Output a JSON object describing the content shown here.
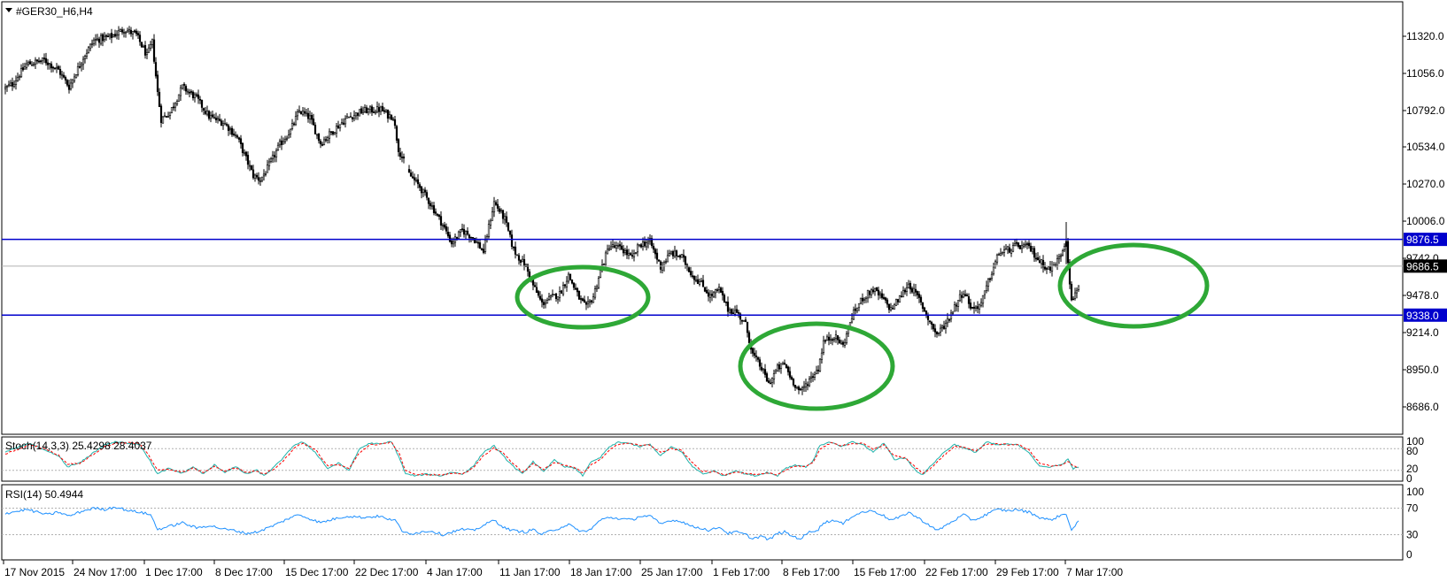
{
  "window": {
    "title": "#GER30_H6,H4"
  },
  "price_panel": {
    "yticks": [
      11320.0,
      11056.0,
      10792.0,
      10534.0,
      10270.0,
      10006.0,
      9742.0,
      9478.0,
      9214.0,
      8950.0,
      8686.0
    ],
    "ytick_labels": [
      "11320.0",
      "11056.0",
      "10792.0",
      "10534.0",
      "10270.0",
      "10006.0",
      "9742.0",
      "9478.0",
      "9214.0",
      "8950.0",
      "8686.0"
    ],
    "ylim": [
      8640,
      11480
    ],
    "resistance": {
      "value": 9876.5,
      "label": "9876.5",
      "color": "#0000cc"
    },
    "support": {
      "value": 9338.0,
      "label": "9338.0",
      "color": "#0000cc"
    },
    "current": {
      "value": 9686.5,
      "label": "9686.5"
    },
    "ellipse_color": "#2ea836"
  },
  "stoch_panel": {
    "title": "Stoch(14,3,3) 25.4298 28.4037",
    "levels": [
      "100",
      "80",
      "20",
      "0"
    ],
    "main_color": "#20b2aa",
    "signal_color": "#ff0000"
  },
  "rsi_panel": {
    "title": "RSI(14) 50.4944",
    "levels": [
      "100",
      "70",
      "30",
      "0"
    ],
    "color": "#1e90ff"
  },
  "x_axis": {
    "labels": [
      "17 Nov 2015",
      "24 Nov 17:00",
      "1 Dec 17:00",
      "8 Dec 17:00",
      "15 Dec 17:00",
      "22 Dec 17:00",
      "4 Jan 17:00",
      "11 Jan 17:00",
      "18 Jan 17:00",
      "25 Jan 17:00",
      "1 Feb 17:00",
      "8 Feb 17:00",
      "15 Feb 17:00",
      "22 Feb 17:00",
      "29 Feb 17:00",
      "7 Mar 17:00"
    ]
  },
  "chart_data": {
    "type": "candlestick",
    "title": "#GER30_H6,H4",
    "ylim": [
      8640,
      11480
    ],
    "anchors": [
      [
        0,
        10950
      ],
      [
        4,
        10980
      ],
      [
        12,
        11120
      ],
      [
        22,
        11150
      ],
      [
        30,
        11080
      ],
      [
        36,
        10960
      ],
      [
        44,
        11170
      ],
      [
        50,
        11290
      ],
      [
        60,
        11320
      ],
      [
        67,
        11370
      ],
      [
        74,
        11330
      ],
      [
        80,
        11180
      ],
      [
        83,
        11280
      ],
      [
        86,
        10920
      ],
      [
        88,
        10730
      ],
      [
        93,
        10780
      ],
      [
        100,
        10960
      ],
      [
        108,
        10880
      ],
      [
        115,
        10750
      ],
      [
        124,
        10700
      ],
      [
        131,
        10600
      ],
      [
        140,
        10330
      ],
      [
        144,
        10300
      ],
      [
        148,
        10380
      ],
      [
        155,
        10550
      ],
      [
        161,
        10650
      ],
      [
        166,
        10790
      ],
      [
        172,
        10740
      ],
      [
        178,
        10560
      ],
      [
        186,
        10660
      ],
      [
        193,
        10740
      ],
      [
        202,
        10790
      ],
      [
        212,
        10800
      ],
      [
        216,
        10760
      ],
      [
        219,
        10750
      ],
      [
        222,
        10520
      ],
      [
        228,
        10340
      ],
      [
        234,
        10250
      ],
      [
        240,
        10130
      ],
      [
        247,
        9980
      ],
      [
        252,
        9850
      ],
      [
        258,
        9940
      ],
      [
        264,
        9890
      ],
      [
        270,
        9790
      ],
      [
        276,
        10140
      ],
      [
        282,
        10020
      ],
      [
        287,
        9800
      ],
      [
        294,
        9680
      ],
      [
        298,
        9550
      ],
      [
        303,
        9420
      ],
      [
        308,
        9460
      ],
      [
        313,
        9490
      ],
      [
        318,
        9620
      ],
      [
        321,
        9540
      ],
      [
        324,
        9460
      ],
      [
        328,
        9390
      ],
      [
        332,
        9470
      ],
      [
        336,
        9650
      ],
      [
        341,
        9830
      ],
      [
        348,
        9810
      ],
      [
        354,
        9740
      ],
      [
        358,
        9840
      ],
      [
        364,
        9860
      ],
      [
        370,
        9680
      ],
      [
        376,
        9780
      ],
      [
        382,
        9750
      ],
      [
        388,
        9620
      ],
      [
        393,
        9560
      ],
      [
        398,
        9470
      ],
      [
        403,
        9520
      ],
      [
        408,
        9380
      ],
      [
        413,
        9360
      ],
      [
        418,
        9270
      ],
      [
        422,
        9060
      ],
      [
        427,
        8960
      ],
      [
        431,
        8850
      ],
      [
        436,
        8960
      ],
      [
        440,
        8990
      ],
      [
        444,
        8880
      ],
      [
        449,
        8790
      ],
      [
        454,
        8880
      ],
      [
        459,
        8960
      ],
      [
        462,
        9150
      ],
      [
        468,
        9190
      ],
      [
        473,
        9120
      ],
      [
        478,
        9330
      ],
      [
        484,
        9460
      ],
      [
        490,
        9520
      ],
      [
        495,
        9460
      ],
      [
        500,
        9380
      ],
      [
        505,
        9460
      ],
      [
        510,
        9560
      ],
      [
        516,
        9450
      ],
      [
        522,
        9290
      ],
      [
        526,
        9200
      ],
      [
        531,
        9280
      ],
      [
        536,
        9400
      ],
      [
        541,
        9510
      ],
      [
        546,
        9380
      ],
      [
        551,
        9420
      ],
      [
        556,
        9610
      ],
      [
        561,
        9780
      ],
      [
        566,
        9800
      ],
      [
        571,
        9830
      ],
      [
        578,
        9820
      ],
      [
        584,
        9720
      ],
      [
        590,
        9660
      ],
      [
        595,
        9740
      ],
      [
        599,
        9880
      ],
      [
        602,
        9430
      ],
      [
        606,
        9560
      ]
    ],
    "horizontal_lines": [
      {
        "label": "9876.5",
        "value": 9876.5
      },
      {
        "label": "9338.0",
        "value": 9338.0
      }
    ],
    "current_price": 9686.5
  },
  "stoch_data": {
    "ylim": [
      0,
      100
    ],
    "main": [
      [
        0,
        70
      ],
      [
        8,
        85
      ],
      [
        14,
        95
      ],
      [
        22,
        75
      ],
      [
        30,
        60
      ],
      [
        35,
        30
      ],
      [
        42,
        40
      ],
      [
        50,
        70
      ],
      [
        56,
        90
      ],
      [
        62,
        98
      ],
      [
        70,
        95
      ],
      [
        76,
        92
      ],
      [
        80,
        60
      ],
      [
        86,
        10
      ],
      [
        92,
        25
      ],
      [
        100,
        12
      ],
      [
        106,
        30
      ],
      [
        112,
        10
      ],
      [
        118,
        35
      ],
      [
        124,
        15
      ],
      [
        130,
        30
      ],
      [
        136,
        10
      ],
      [
        142,
        20
      ],
      [
        146,
        5
      ],
      [
        152,
        30
      ],
      [
        158,
        60
      ],
      [
        163,
        90
      ],
      [
        168,
        98
      ],
      [
        175,
        70
      ],
      [
        182,
        25
      ],
      [
        188,
        40
      ],
      [
        194,
        20
      ],
      [
        200,
        80
      ],
      [
        206,
        95
      ],
      [
        212,
        92
      ],
      [
        218,
        100
      ],
      [
        222,
        60
      ],
      [
        226,
        10
      ],
      [
        232,
        5
      ],
      [
        238,
        10
      ],
      [
        246,
        5
      ],
      [
        252,
        15
      ],
      [
        258,
        10
      ],
      [
        264,
        30
      ],
      [
        270,
        70
      ],
      [
        276,
        88
      ],
      [
        281,
        60
      ],
      [
        287,
        30
      ],
      [
        292,
        10
      ],
      [
        298,
        45
      ],
      [
        304,
        15
      ],
      [
        310,
        50
      ],
      [
        316,
        30
      ],
      [
        322,
        25
      ],
      [
        326,
        5
      ],
      [
        330,
        40
      ],
      [
        336,
        55
      ],
      [
        340,
        80
      ],
      [
        346,
        98
      ],
      [
        352,
        95
      ],
      [
        358,
        85
      ],
      [
        364,
        92
      ],
      [
        370,
        60
      ],
      [
        376,
        85
      ],
      [
        382,
        70
      ],
      [
        388,
        30
      ],
      [
        394,
        10
      ],
      [
        400,
        18
      ],
      [
        406,
        5
      ],
      [
        412,
        20
      ],
      [
        418,
        10
      ],
      [
        424,
        5
      ],
      [
        430,
        15
      ],
      [
        436,
        5
      ],
      [
        440,
        25
      ],
      [
        446,
        35
      ],
      [
        452,
        30
      ],
      [
        456,
        45
      ],
      [
        460,
        90
      ],
      [
        466,
        98
      ],
      [
        472,
        85
      ],
      [
        478,
        98
      ],
      [
        484,
        92
      ],
      [
        490,
        70
      ],
      [
        496,
        96
      ],
      [
        502,
        50
      ],
      [
        508,
        55
      ],
      [
        514,
        20
      ],
      [
        518,
        8
      ],
      [
        524,
        40
      ],
      [
        530,
        70
      ],
      [
        536,
        92
      ],
      [
        542,
        80
      ],
      [
        548,
        70
      ],
      [
        554,
        98
      ],
      [
        560,
        90
      ],
      [
        566,
        92
      ],
      [
        572,
        90
      ],
      [
        578,
        70
      ],
      [
        584,
        30
      ],
      [
        590,
        30
      ],
      [
        596,
        35
      ],
      [
        600,
        50
      ],
      [
        603,
        25
      ],
      [
        606,
        28
      ]
    ],
    "signal": [
      [
        0,
        65
      ],
      [
        8,
        80
      ],
      [
        14,
        92
      ],
      [
        22,
        80
      ],
      [
        30,
        62
      ],
      [
        35,
        38
      ],
      [
        42,
        40
      ],
      [
        50,
        65
      ],
      [
        56,
        85
      ],
      [
        62,
        95
      ],
      [
        70,
        96
      ],
      [
        76,
        93
      ],
      [
        80,
        70
      ],
      [
        86,
        20
      ],
      [
        92,
        22
      ],
      [
        100,
        15
      ],
      [
        106,
        26
      ],
      [
        112,
        14
      ],
      [
        118,
        30
      ],
      [
        124,
        18
      ],
      [
        130,
        28
      ],
      [
        136,
        14
      ],
      [
        142,
        18
      ],
      [
        146,
        10
      ],
      [
        152,
        25
      ],
      [
        158,
        52
      ],
      [
        163,
        82
      ],
      [
        168,
        95
      ],
      [
        175,
        78
      ],
      [
        182,
        32
      ],
      [
        188,
        36
      ],
      [
        194,
        24
      ],
      [
        200,
        70
      ],
      [
        206,
        90
      ],
      [
        212,
        93
      ],
      [
        218,
        97
      ],
      [
        222,
        70
      ],
      [
        226,
        20
      ],
      [
        232,
        8
      ],
      [
        238,
        9
      ],
      [
        246,
        7
      ],
      [
        252,
        12
      ],
      [
        258,
        11
      ],
      [
        264,
        25
      ],
      [
        270,
        60
      ],
      [
        276,
        82
      ],
      [
        281,
        68
      ],
      [
        287,
        38
      ],
      [
        292,
        15
      ],
      [
        298,
        38
      ],
      [
        304,
        22
      ],
      [
        310,
        42
      ],
      [
        316,
        34
      ],
      [
        322,
        27
      ],
      [
        326,
        12
      ],
      [
        330,
        32
      ],
      [
        336,
        50
      ],
      [
        340,
        72
      ],
      [
        346,
        92
      ],
      [
        352,
        96
      ],
      [
        358,
        88
      ],
      [
        364,
        90
      ],
      [
        370,
        70
      ],
      [
        376,
        80
      ],
      [
        382,
        74
      ],
      [
        388,
        40
      ],
      [
        394,
        16
      ],
      [
        400,
        16
      ],
      [
        406,
        8
      ],
      [
        412,
        16
      ],
      [
        418,
        12
      ],
      [
        424,
        7
      ],
      [
        430,
        12
      ],
      [
        436,
        8
      ],
      [
        440,
        20
      ],
      [
        446,
        32
      ],
      [
        452,
        31
      ],
      [
        456,
        40
      ],
      [
        460,
        80
      ],
      [
        466,
        95
      ],
      [
        472,
        89
      ],
      [
        478,
        94
      ],
      [
        484,
        94
      ],
      [
        490,
        78
      ],
      [
        496,
        90
      ],
      [
        502,
        60
      ],
      [
        508,
        54
      ],
      [
        514,
        28
      ],
      [
        518,
        12
      ],
      [
        524,
        32
      ],
      [
        530,
        62
      ],
      [
        536,
        86
      ],
      [
        542,
        82
      ],
      [
        548,
        74
      ],
      [
        554,
        92
      ],
      [
        560,
        93
      ],
      [
        566,
        91
      ],
      [
        572,
        91
      ],
      [
        578,
        76
      ],
      [
        584,
        40
      ],
      [
        590,
        32
      ],
      [
        596,
        33
      ],
      [
        600,
        44
      ],
      [
        603,
        32
      ],
      [
        606,
        28
      ]
    ]
  },
  "rsi_data": {
    "ylim": [
      0,
      100
    ],
    "values": [
      [
        0,
        62
      ],
      [
        6,
        65
      ],
      [
        12,
        68
      ],
      [
        18,
        64
      ],
      [
        24,
        60
      ],
      [
        30,
        64
      ],
      [
        36,
        58
      ],
      [
        44,
        66
      ],
      [
        50,
        70
      ],
      [
        56,
        68
      ],
      [
        62,
        72
      ],
      [
        70,
        66
      ],
      [
        76,
        64
      ],
      [
        82,
        60
      ],
      [
        86,
        38
      ],
      [
        92,
        42
      ],
      [
        100,
        48
      ],
      [
        108,
        40
      ],
      [
        115,
        44
      ],
      [
        124,
        38
      ],
      [
        130,
        36
      ],
      [
        136,
        32
      ],
      [
        142,
        34
      ],
      [
        148,
        40
      ],
      [
        155,
        48
      ],
      [
        161,
        56
      ],
      [
        166,
        60
      ],
      [
        172,
        54
      ],
      [
        178,
        48
      ],
      [
        186,
        54
      ],
      [
        193,
        58
      ],
      [
        202,
        56
      ],
      [
        212,
        58
      ],
      [
        216,
        52
      ],
      [
        220,
        54
      ],
      [
        224,
        34
      ],
      [
        230,
        32
      ],
      [
        240,
        36
      ],
      [
        247,
        30
      ],
      [
        252,
        34
      ],
      [
        258,
        38
      ],
      [
        264,
        36
      ],
      [
        270,
        44
      ],
      [
        276,
        52
      ],
      [
        282,
        40
      ],
      [
        287,
        36
      ],
      [
        294,
        34
      ],
      [
        298,
        38
      ],
      [
        303,
        30
      ],
      [
        308,
        36
      ],
      [
        313,
        40
      ],
      [
        318,
        46
      ],
      [
        322,
        38
      ],
      [
        328,
        34
      ],
      [
        332,
        42
      ],
      [
        336,
        52
      ],
      [
        341,
        56
      ],
      [
        348,
        54
      ],
      [
        354,
        52
      ],
      [
        358,
        58
      ],
      [
        364,
        58
      ],
      [
        370,
        46
      ],
      [
        376,
        52
      ],
      [
        382,
        50
      ],
      [
        388,
        42
      ],
      [
        393,
        40
      ],
      [
        398,
        36
      ],
      [
        403,
        42
      ],
      [
        408,
        32
      ],
      [
        413,
        34
      ],
      [
        418,
        30
      ],
      [
        422,
        24
      ],
      [
        427,
        28
      ],
      [
        431,
        22
      ],
      [
        436,
        32
      ],
      [
        440,
        34
      ],
      [
        444,
        28
      ],
      [
        449,
        24
      ],
      [
        454,
        34
      ],
      [
        459,
        38
      ],
      [
        462,
        48
      ],
      [
        468,
        52
      ],
      [
        473,
        46
      ],
      [
        478,
        58
      ],
      [
        484,
        64
      ],
      [
        490,
        66
      ],
      [
        495,
        60
      ],
      [
        500,
        52
      ],
      [
        505,
        56
      ],
      [
        510,
        64
      ],
      [
        516,
        54
      ],
      [
        522,
        44
      ],
      [
        526,
        36
      ],
      [
        531,
        44
      ],
      [
        536,
        52
      ],
      [
        541,
        60
      ],
      [
        546,
        52
      ],
      [
        551,
        56
      ],
      [
        556,
        64
      ],
      [
        561,
        68
      ],
      [
        566,
        66
      ],
      [
        571,
        68
      ],
      [
        578,
        64
      ],
      [
        584,
        56
      ],
      [
        590,
        52
      ],
      [
        595,
        58
      ],
      [
        599,
        62
      ],
      [
        602,
        36
      ],
      [
        606,
        50
      ]
    ]
  }
}
